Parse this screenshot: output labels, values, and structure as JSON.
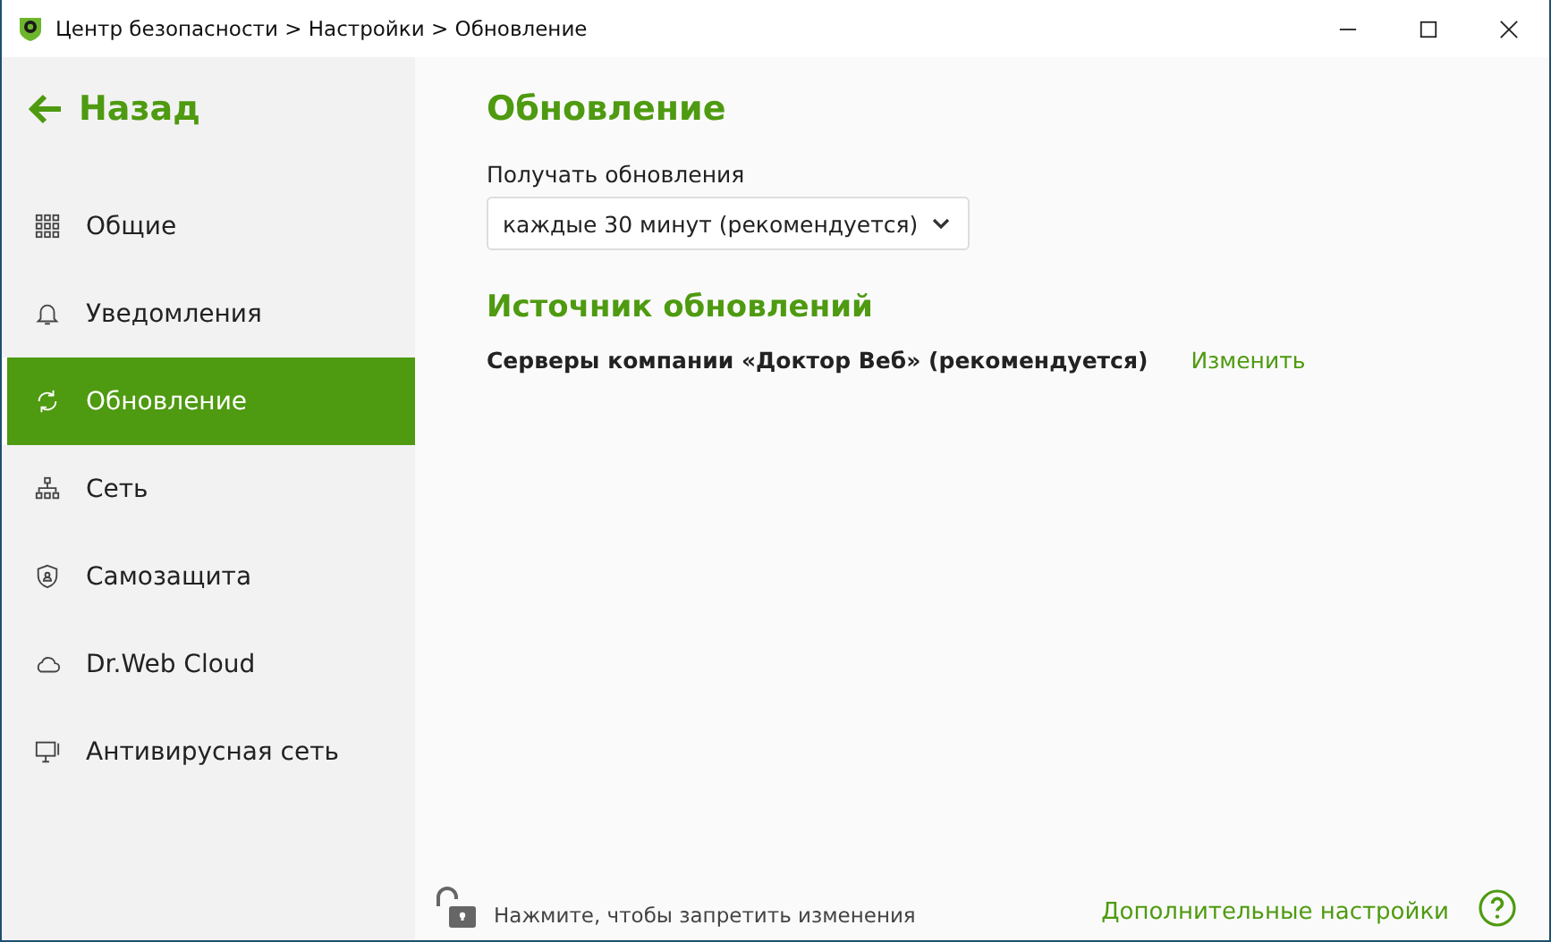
{
  "window": {
    "title": "Центр безопасности > Настройки > Обновление"
  },
  "back": {
    "label": "Назад"
  },
  "sidebar": {
    "items": [
      {
        "label": "Общие",
        "kind": "grid",
        "selected": false
      },
      {
        "label": "Уведомления",
        "kind": "bell",
        "selected": false
      },
      {
        "label": "Обновление",
        "kind": "refresh",
        "selected": true
      },
      {
        "label": "Сеть",
        "kind": "network",
        "selected": false
      },
      {
        "label": "Самозащита",
        "kind": "shield",
        "selected": false
      },
      {
        "label": "Dr.Web Cloud",
        "kind": "cloud",
        "selected": false
      },
      {
        "label": "Антивирусная сеть",
        "kind": "monitor",
        "selected": false
      }
    ]
  },
  "content": {
    "title": "Обновление",
    "frequency": {
      "label": "Получать обновления",
      "value": "каждые 30 минут (рекомендуется)"
    },
    "source": {
      "title": "Источник обновлений",
      "value": "Серверы компании «Доктор Веб» (рекомендуется)",
      "action": "Изменить"
    }
  },
  "footer": {
    "lock_text": "Нажмите, чтобы запретить изменения",
    "advanced": "Дополнительные настройки"
  }
}
